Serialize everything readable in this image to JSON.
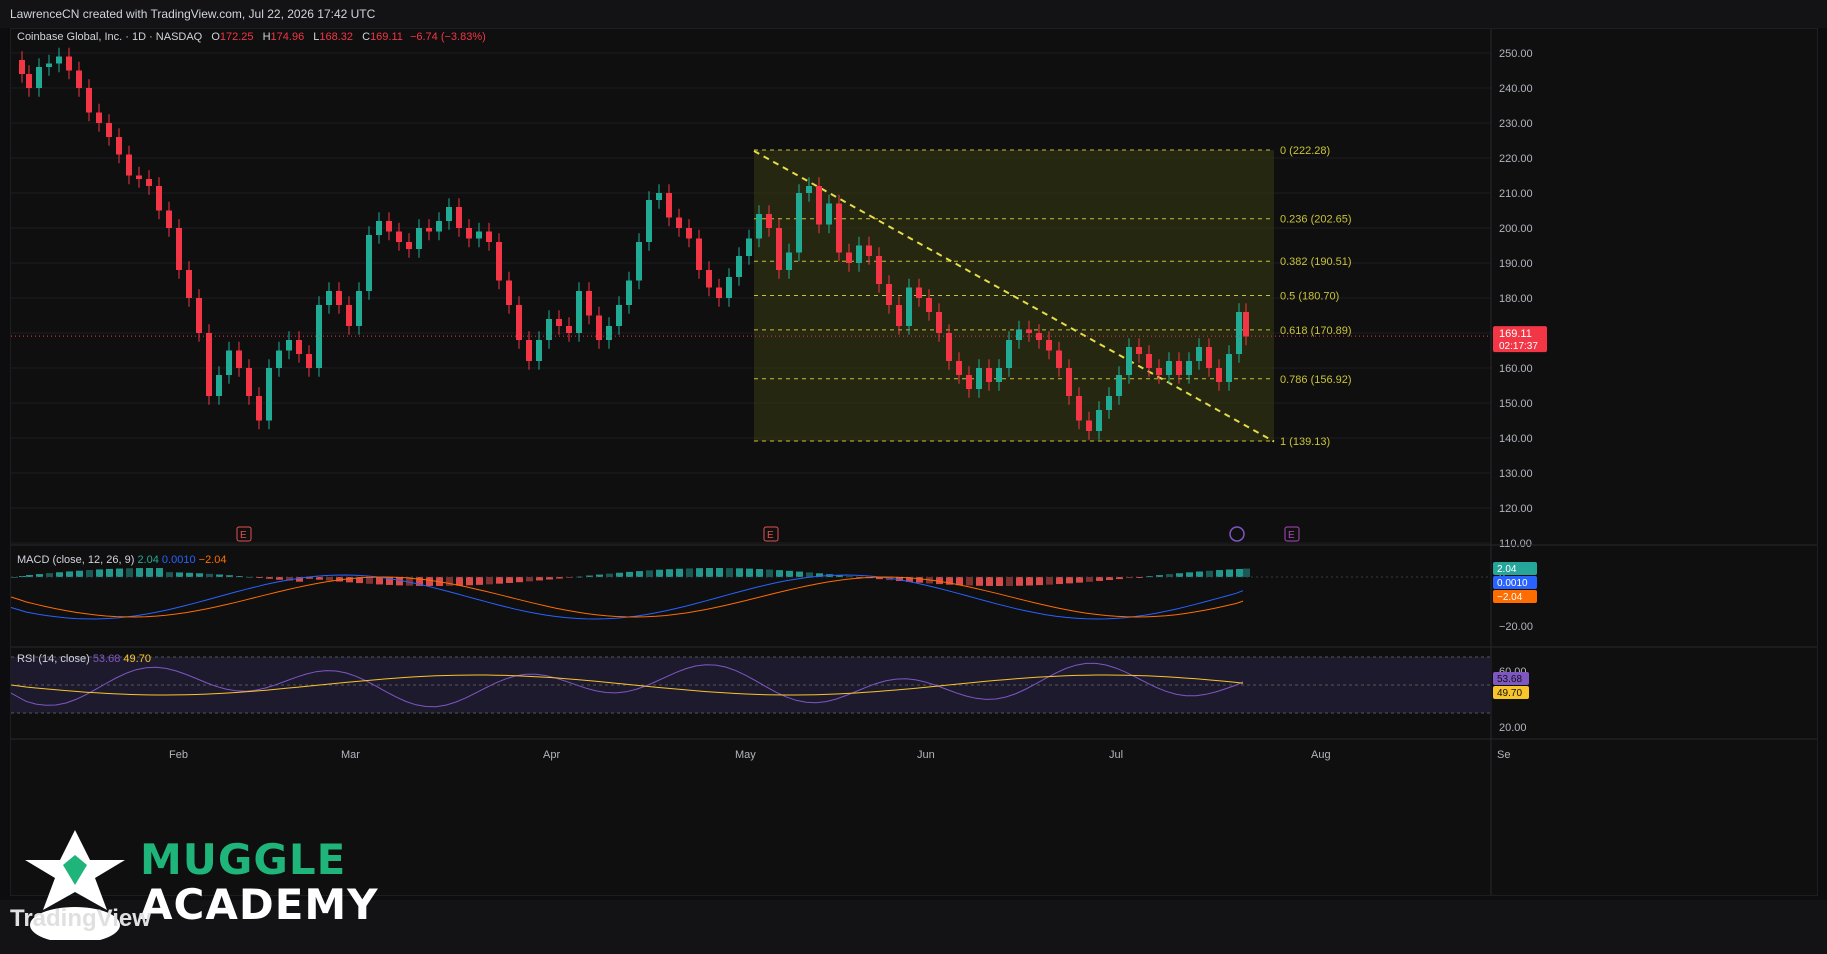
{
  "header": {
    "credit": "LawrenceCN created with TradingView.com, Jul 22, 2026 17:42 UTC"
  },
  "legend": {
    "symbol": "Coinbase Global, Inc. · 1D · NASDAQ",
    "open_label": "O",
    "open": "172.25",
    "high_label": "H",
    "high": "174.96",
    "low_label": "L",
    "low": "168.32",
    "close_label": "C",
    "close": "169.11",
    "change": "−6.74 (−3.83%)"
  },
  "price_axis": {
    "ticks": [
      "250.00",
      "240.00",
      "230.00",
      "220.00",
      "210.00",
      "200.00",
      "190.00",
      "180.00",
      "170.00",
      "160.00",
      "150.00",
      "140.00",
      "130.00",
      "120.00",
      "110.00"
    ],
    "last_price": "169.11",
    "countdown": "02:17:37"
  },
  "time_axis": {
    "labels": [
      "Feb",
      "Mar",
      "Apr",
      "May",
      "Jun",
      "Jul",
      "Aug",
      "Se"
    ]
  },
  "fib": {
    "levels": [
      {
        "label": "0 (222.28)",
        "price": 222.28
      },
      {
        "label": "0.236 (202.65)",
        "price": 202.65
      },
      {
        "label": "0.382 (190.51)",
        "price": 190.51
      },
      {
        "label": "0.5 (180.70)",
        "price": 180.7
      },
      {
        "label": "0.618 (170.89)",
        "price": 170.89
      },
      {
        "label": "0.786 (156.92)",
        "price": 156.92
      },
      {
        "label": "1 (139.13)",
        "price": 139.13
      }
    ]
  },
  "earnings_marker": "E",
  "macd": {
    "title": "MACD (close, 12, 26, 9)",
    "hist": "2.04",
    "macd": "0.0010",
    "signal": "−2.04",
    "axis_ticks": [
      "0",
      "−20.00"
    ]
  },
  "rsi": {
    "title": "RSI (14, close)",
    "rsi": "53.68",
    "ma": "49.70",
    "axis_ticks": [
      "60.00",
      "20.00"
    ]
  },
  "brand": {
    "line1": "MUGGLE",
    "line2": "ACADEMY",
    "tv": "TradingView"
  },
  "colors": {
    "up": "#22ab94",
    "down": "#f23645",
    "fib": "#c9c23a",
    "macd": "#2962ff",
    "signal": "#ff6d00",
    "rsi": "#7e57c2",
    "rsi_ma": "#f7c52b",
    "brand_green": "#1fb47a"
  },
  "chart_data": {
    "type": "candlestick",
    "title": "Coinbase Global, Inc. · 1D · NASDAQ",
    "ylim": [
      110,
      255
    ],
    "series_close_approx": [
      {
        "x": "Jan",
        "y": 243
      },
      {
        "x": "Jan",
        "y": 233
      },
      {
        "x": "Jan",
        "y": 215
      },
      {
        "x": "Feb",
        "y": 185
      },
      {
        "x": "Feb",
        "y": 150
      },
      {
        "x": "Feb",
        "y": 165
      },
      {
        "x": "Mar",
        "y": 180
      },
      {
        "x": "Mar",
        "y": 200
      },
      {
        "x": "Mar",
        "y": 195
      },
      {
        "x": "Mar",
        "y": 185
      },
      {
        "x": "Apr",
        "y": 165
      },
      {
        "x": "Apr",
        "y": 175
      },
      {
        "x": "Apr",
        "y": 185
      },
      {
        "x": "Apr",
        "y": 205
      },
      {
        "x": "Apr",
        "y": 195
      },
      {
        "x": "May",
        "y": 205
      },
      {
        "x": "May",
        "y": 215
      },
      {
        "x": "May",
        "y": 195
      },
      {
        "x": "Jun",
        "y": 175
      },
      {
        "x": "Jun",
        "y": 155
      },
      {
        "x": "Jun",
        "y": 165
      },
      {
        "x": "Jun",
        "y": 150
      },
      {
        "x": "Jul",
        "y": 143
      },
      {
        "x": "Jul",
        "y": 165
      },
      {
        "x": "Jul",
        "y": 160
      },
      {
        "x": "Jul",
        "y": 169.11
      }
    ]
  }
}
